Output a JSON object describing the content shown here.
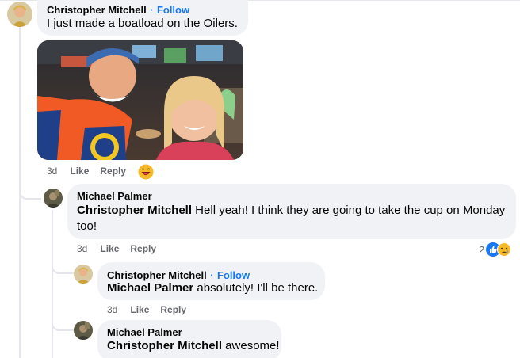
{
  "comments": [
    {
      "author": "Christopher Mitchell",
      "follow_label": "Follow",
      "text": "I just made a boatload on the Oilers.",
      "time": "3d",
      "like_label": "Like",
      "reply_label": "Reply"
    },
    {
      "author": "Michael Palmer",
      "mention": "Christopher Mitchell",
      "text": " Hell yeah! I think they are going to take the cup on Monday too!",
      "time": "3d",
      "like_label": "Like",
      "reply_label": "Reply",
      "reaction_count": "2"
    },
    {
      "author": "Christopher Mitchell",
      "follow_label": "Follow",
      "mention": "Michael Palmer",
      "text": " absolutely! I'll be there.",
      "time": "3d",
      "like_label": "Like",
      "reply_label": "Reply"
    },
    {
      "author": "Michael Palmer",
      "mention": "Christopher Mitchell",
      "text": " awesome!"
    }
  ],
  "icons": {
    "laugh_reaction": "laughing-emoji-icon",
    "like_reaction": "like-thumb-icon",
    "sad_reaction": "sad-emoji-icon"
  },
  "colors": {
    "bubble": "#f0f2f5",
    "follow": "#1877f2",
    "meta": "#65676b",
    "jersey": "#f15a24",
    "jersey_blue": "#1f3f88"
  }
}
